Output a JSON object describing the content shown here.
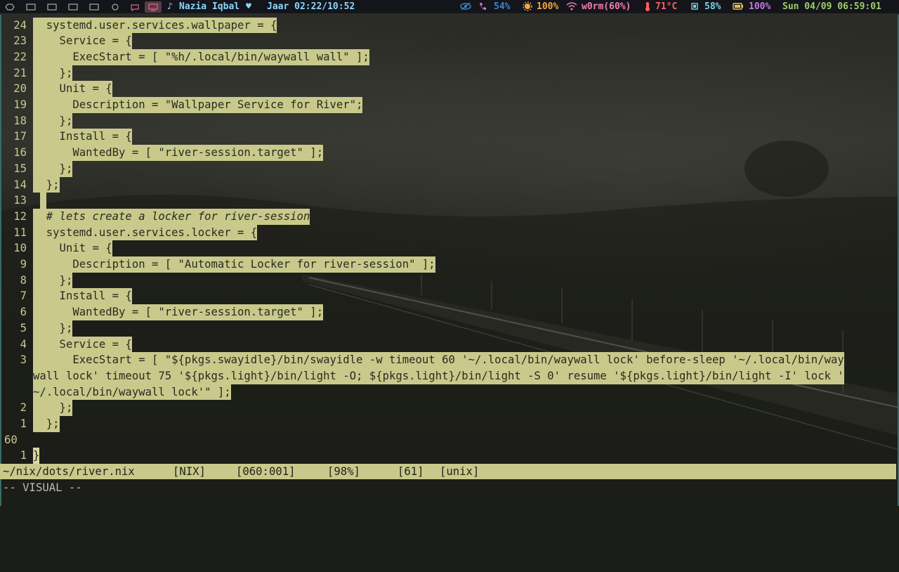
{
  "topbar": {
    "note_icon": "♪",
    "user": "Nazia Iqbal",
    "heart": "♥",
    "clock_label": "Jaar 02:22/10:52",
    "privacy_percent": "54%",
    "brightness": "100%",
    "wifi": "w0rm(60%)",
    "temperature": "71°C",
    "cpu": "58%",
    "battery": "100%",
    "datetime": "Sun 04/09 06:59:01",
    "colors": {
      "user": "#8bd5ff",
      "clock": "#8bd5ff",
      "privacy": "#3a86c8",
      "phone": "#c678dd",
      "brightness": "#f5a742",
      "wifi": "#f47fb0",
      "temp": "#ff5f5f",
      "cpu": "#7fd0e8",
      "battery": "#f0c04a",
      "datetime": "#9ece6a"
    }
  },
  "editor": {
    "lines": [
      {
        "num": "24",
        "text": "  systemd.user.services.wallpaper = {"
      },
      {
        "num": "23",
        "text": "    Service = {"
      },
      {
        "num": "22",
        "text": "      ExecStart = [ \"%h/.local/bin/waywall wall\" ];"
      },
      {
        "num": "21",
        "text": "    };"
      },
      {
        "num": "20",
        "text": "    Unit = {"
      },
      {
        "num": "19",
        "text": "      Description = \"Wallpaper Service for River\";"
      },
      {
        "num": "18",
        "text": "    };"
      },
      {
        "num": "17",
        "text": "    Install = {"
      },
      {
        "num": "16",
        "text": "      WantedBy = [ \"river-session.target\" ];"
      },
      {
        "num": "15",
        "text": "    };"
      },
      {
        "num": "14",
        "text": "  };"
      },
      {
        "num": "13",
        "text": ""
      },
      {
        "num": "12",
        "text": "  # lets create a locker for river-session"
      },
      {
        "num": "11",
        "text": "  systemd.user.services.locker = {"
      },
      {
        "num": "10",
        "text": "    Unit = {"
      },
      {
        "num": "9",
        "text": "      Description = [ \"Automatic Locker for river-session\" ];"
      },
      {
        "num": "8",
        "text": "    };"
      },
      {
        "num": "7",
        "text": "    Install = {"
      },
      {
        "num": "6",
        "text": "      WantedBy = [ \"river-session.target\" ];"
      },
      {
        "num": "5",
        "text": "    };"
      },
      {
        "num": "4",
        "text": "    Service = {"
      },
      {
        "num": "3",
        "text": "      ExecStart = [ \"${pkgs.swayidle}/bin/swayidle -w timeout 60 '~/.local/bin/waywall lock' before-sleep '~/.local/bin/way"
      },
      {
        "num": "",
        "text": "wall lock' timeout 75 '${pkgs.light}/bin/light -O; ${pkgs.light}/bin/light -S 0' resume '${pkgs.light}/bin/light -I' lock '"
      },
      {
        "num": "",
        "text": "~/.local/bin/waywall lock'\" ];"
      },
      {
        "num": "2",
        "text": "    };"
      },
      {
        "num": "1",
        "text": "  };"
      },
      {
        "num": "60",
        "text": ""
      },
      {
        "num": "1",
        "text": "}"
      }
    ]
  },
  "statusline": {
    "file": "~/nix/dots/river.nix",
    "filetype": "[NIX]",
    "position": "[060:001]",
    "percent": "[98%]",
    "total": "[61]",
    "format": "[unix]"
  },
  "mode": "-- VISUAL --"
}
